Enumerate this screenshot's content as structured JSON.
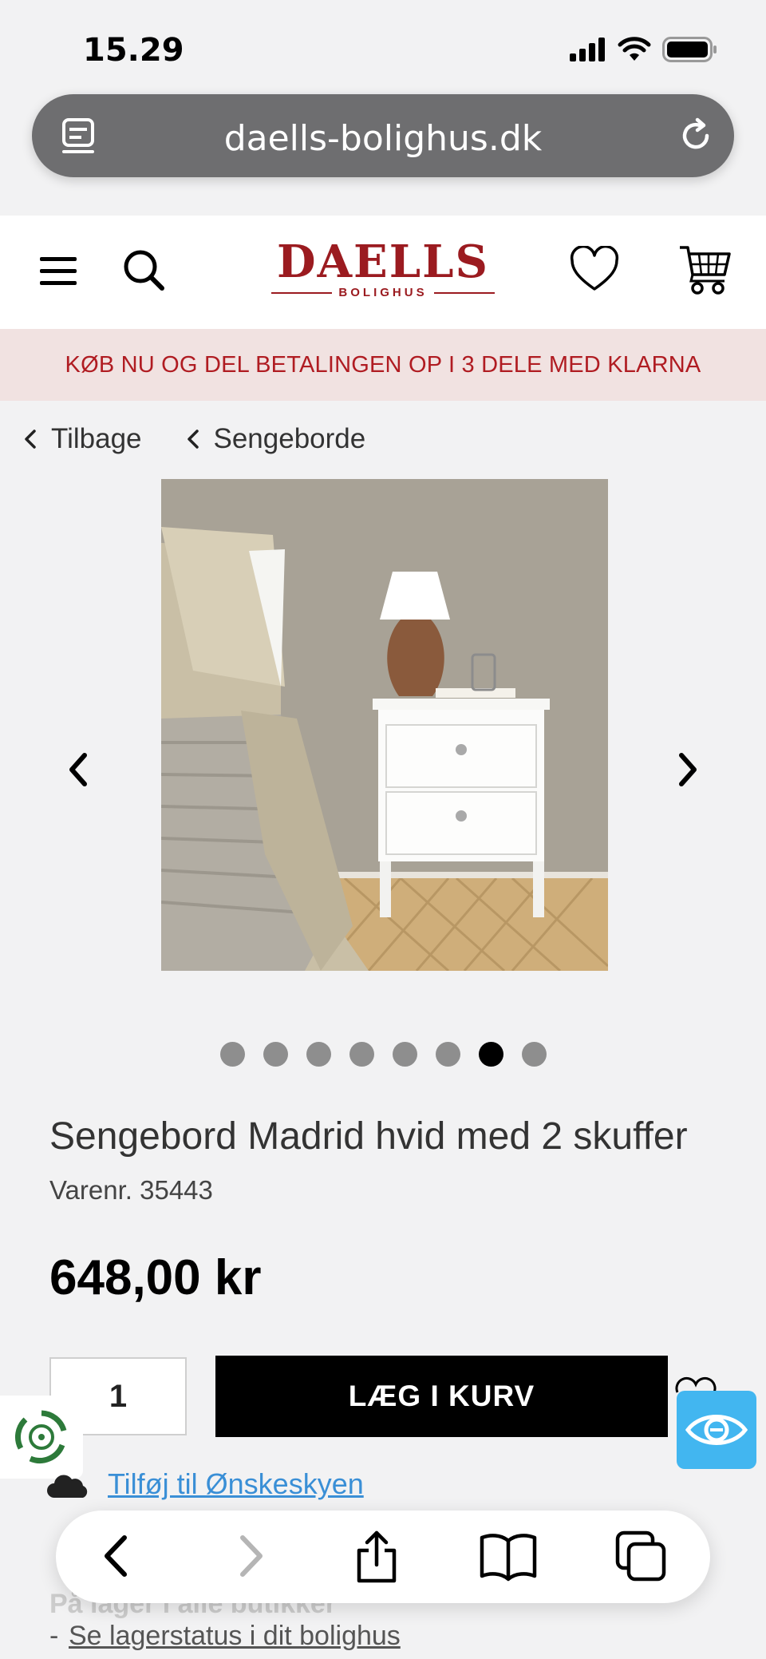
{
  "status": {
    "time": "15.29"
  },
  "browser": {
    "url": "daells-bolighus.dk"
  },
  "brand": {
    "name": "DAELLS",
    "sub": "BOLIGHUS"
  },
  "promo": {
    "text": "KØB NU OG DEL BETALINGEN OP I 3 DELE MED KLARNA"
  },
  "breadcrumbs": {
    "back": "Tilbage",
    "category": "Sengeborde"
  },
  "gallery": {
    "image_count": 8,
    "active_index": 6
  },
  "product": {
    "title": "Sengebord Madrid hvid med 2 skuffer",
    "sku": "Varenr. 35443",
    "price": "648,00 kr",
    "quantity": "1",
    "add_to_cart": "LÆG I KURV",
    "wishlist_link": "Tilføj til Ønskeskyen",
    "stock_status": "På lager i alle butikker",
    "stock_link": "Se lagerstatus i dit bolighus"
  },
  "colors": {
    "brand_red": "#9b1b20",
    "promo_bg": "#f1e2e1",
    "link_blue": "#3a8fd6",
    "accessibility_blue": "#42b6f0"
  }
}
